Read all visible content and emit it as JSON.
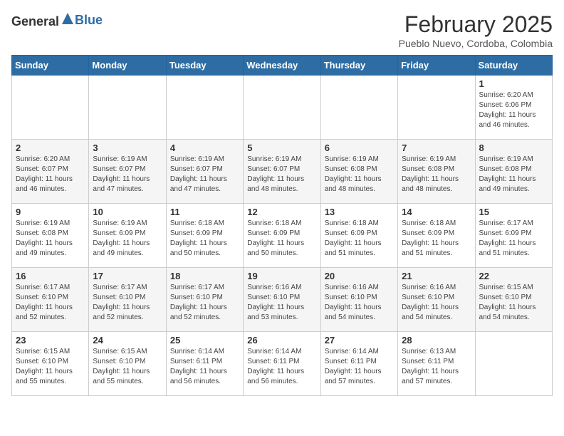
{
  "header": {
    "logo_general": "General",
    "logo_blue": "Blue",
    "title": "February 2025",
    "subtitle": "Pueblo Nuevo, Cordoba, Colombia"
  },
  "days_of_week": [
    "Sunday",
    "Monday",
    "Tuesday",
    "Wednesday",
    "Thursday",
    "Friday",
    "Saturday"
  ],
  "weeks": [
    [
      {
        "day": "",
        "info": ""
      },
      {
        "day": "",
        "info": ""
      },
      {
        "day": "",
        "info": ""
      },
      {
        "day": "",
        "info": ""
      },
      {
        "day": "",
        "info": ""
      },
      {
        "day": "",
        "info": ""
      },
      {
        "day": "1",
        "info": "Sunrise: 6:20 AM\nSunset: 6:06 PM\nDaylight: 11 hours and 46 minutes."
      }
    ],
    [
      {
        "day": "2",
        "info": "Sunrise: 6:20 AM\nSunset: 6:07 PM\nDaylight: 11 hours and 46 minutes."
      },
      {
        "day": "3",
        "info": "Sunrise: 6:19 AM\nSunset: 6:07 PM\nDaylight: 11 hours and 47 minutes."
      },
      {
        "day": "4",
        "info": "Sunrise: 6:19 AM\nSunset: 6:07 PM\nDaylight: 11 hours and 47 minutes."
      },
      {
        "day": "5",
        "info": "Sunrise: 6:19 AM\nSunset: 6:07 PM\nDaylight: 11 hours and 48 minutes."
      },
      {
        "day": "6",
        "info": "Sunrise: 6:19 AM\nSunset: 6:08 PM\nDaylight: 11 hours and 48 minutes."
      },
      {
        "day": "7",
        "info": "Sunrise: 6:19 AM\nSunset: 6:08 PM\nDaylight: 11 hours and 48 minutes."
      },
      {
        "day": "8",
        "info": "Sunrise: 6:19 AM\nSunset: 6:08 PM\nDaylight: 11 hours and 49 minutes."
      }
    ],
    [
      {
        "day": "9",
        "info": "Sunrise: 6:19 AM\nSunset: 6:08 PM\nDaylight: 11 hours and 49 minutes."
      },
      {
        "day": "10",
        "info": "Sunrise: 6:19 AM\nSunset: 6:09 PM\nDaylight: 11 hours and 49 minutes."
      },
      {
        "day": "11",
        "info": "Sunrise: 6:18 AM\nSunset: 6:09 PM\nDaylight: 11 hours and 50 minutes."
      },
      {
        "day": "12",
        "info": "Sunrise: 6:18 AM\nSunset: 6:09 PM\nDaylight: 11 hours and 50 minutes."
      },
      {
        "day": "13",
        "info": "Sunrise: 6:18 AM\nSunset: 6:09 PM\nDaylight: 11 hours and 51 minutes."
      },
      {
        "day": "14",
        "info": "Sunrise: 6:18 AM\nSunset: 6:09 PM\nDaylight: 11 hours and 51 minutes."
      },
      {
        "day": "15",
        "info": "Sunrise: 6:17 AM\nSunset: 6:09 PM\nDaylight: 11 hours and 51 minutes."
      }
    ],
    [
      {
        "day": "16",
        "info": "Sunrise: 6:17 AM\nSunset: 6:10 PM\nDaylight: 11 hours and 52 minutes."
      },
      {
        "day": "17",
        "info": "Sunrise: 6:17 AM\nSunset: 6:10 PM\nDaylight: 11 hours and 52 minutes."
      },
      {
        "day": "18",
        "info": "Sunrise: 6:17 AM\nSunset: 6:10 PM\nDaylight: 11 hours and 52 minutes."
      },
      {
        "day": "19",
        "info": "Sunrise: 6:16 AM\nSunset: 6:10 PM\nDaylight: 11 hours and 53 minutes."
      },
      {
        "day": "20",
        "info": "Sunrise: 6:16 AM\nSunset: 6:10 PM\nDaylight: 11 hours and 54 minutes."
      },
      {
        "day": "21",
        "info": "Sunrise: 6:16 AM\nSunset: 6:10 PM\nDaylight: 11 hours and 54 minutes."
      },
      {
        "day": "22",
        "info": "Sunrise: 6:15 AM\nSunset: 6:10 PM\nDaylight: 11 hours and 54 minutes."
      }
    ],
    [
      {
        "day": "23",
        "info": "Sunrise: 6:15 AM\nSunset: 6:10 PM\nDaylight: 11 hours and 55 minutes."
      },
      {
        "day": "24",
        "info": "Sunrise: 6:15 AM\nSunset: 6:10 PM\nDaylight: 11 hours and 55 minutes."
      },
      {
        "day": "25",
        "info": "Sunrise: 6:14 AM\nSunset: 6:11 PM\nDaylight: 11 hours and 56 minutes."
      },
      {
        "day": "26",
        "info": "Sunrise: 6:14 AM\nSunset: 6:11 PM\nDaylight: 11 hours and 56 minutes."
      },
      {
        "day": "27",
        "info": "Sunrise: 6:14 AM\nSunset: 6:11 PM\nDaylight: 11 hours and 57 minutes."
      },
      {
        "day": "28",
        "info": "Sunrise: 6:13 AM\nSunset: 6:11 PM\nDaylight: 11 hours and 57 minutes."
      },
      {
        "day": "",
        "info": ""
      }
    ]
  ]
}
